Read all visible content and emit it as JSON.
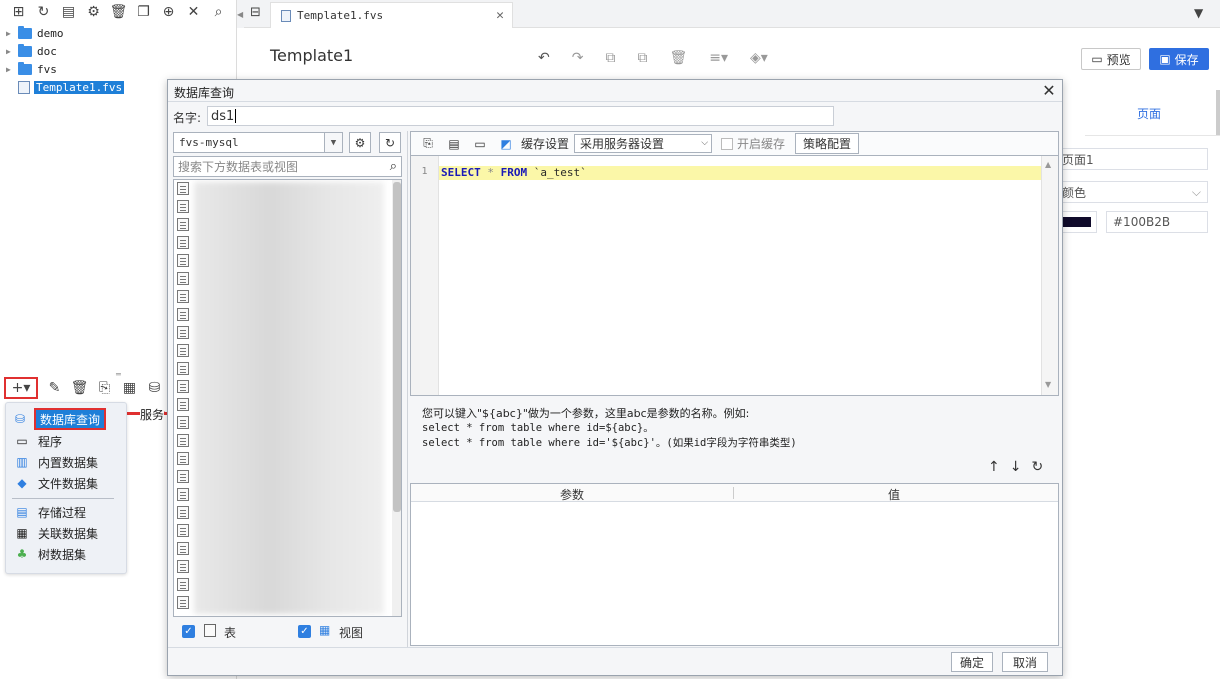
{
  "tree": {
    "items": [
      {
        "label": "demo",
        "type": "folder"
      },
      {
        "label": "doc",
        "type": "folder"
      },
      {
        "label": "fvs",
        "type": "folder"
      },
      {
        "label": "Template1.fvs",
        "type": "file",
        "selected": true
      }
    ]
  },
  "dataset_menu": {
    "items": [
      "数据库查询",
      "程序",
      "内置数据集",
      "文件数据集",
      "存储过程",
      "关联数据集",
      "树数据集"
    ],
    "partial_label": "服务"
  },
  "tab": {
    "label": "Template1.fvs"
  },
  "page_title": "Template1",
  "buttons": {
    "preview": "预览",
    "save": "保存"
  },
  "right_panel": {
    "tab_label": "页面",
    "name_value": "页面1",
    "color_mode": "颜色",
    "color_hex": "#100B2B",
    "swatch_color": "#100B2B"
  },
  "dialog": {
    "title": "数据库查询",
    "name_label": "名字:",
    "name_value": "ds1",
    "datasource": "fvs-mysql",
    "search_placeholder": "搜索下方数据表或视图",
    "table_label": "表",
    "view_label": "视图",
    "cache_label": "缓存设置",
    "cache_option": "采用服务器设置",
    "enable_cache": "开启缓存",
    "strategy": "策略配置",
    "sql": {
      "line_no": "1",
      "kw1": "SELECT",
      "star": "*",
      "kw2": "FROM",
      "table": "`a_test`"
    },
    "hint_lines": [
      "您可以键入\"${abc}\"做为一个参数，这里abc是参数的名称。例如:",
      "select * from table where id=${abc}。",
      "select * from table where id='${abc}'。(如果id字段为字符串类型)"
    ],
    "param_headers": [
      "参数",
      "值"
    ],
    "ok": "确定",
    "cancel": "取消"
  }
}
